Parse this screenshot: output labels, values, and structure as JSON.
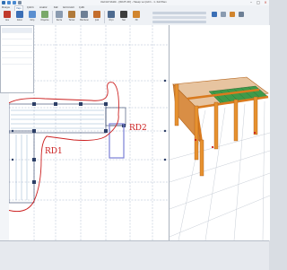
{
  "window": {
    "title": "IdeCAD Statik - [RD2F-2D] - Hesap ve Çizim - 1. Kat Planı",
    "controls": [
      "–",
      "□",
      "×"
    ]
  },
  "ribbon": {
    "tabs": [
      "Dosya",
      "Yapı",
      "Çizim",
      "Analiz",
      "Kat",
      "Görünüm",
      "Çıktı"
    ],
    "active_tab_index": 1,
    "labels": [
      "Aks",
      "Kolon",
      "Kiriş",
      "Döşeme",
      "Perde",
      "Temel",
      "Merdiven",
      "Çatı",
      "Ölçü",
      "Yazı",
      "3D"
    ]
  },
  "plan": {
    "annotations": [
      {
        "label": "RD1",
        "color": "#cc1f1f"
      },
      {
        "label": "RD2",
        "color": "#cc1f1f"
      }
    ]
  },
  "colors": {
    "annotation": "#cc1f1f",
    "beam": "#e38a22",
    "slab_mesh": "#2e8b3c",
    "grid": "#2c3e66",
    "highlight": "#7a7fd6"
  },
  "icons": [
    "save-icon",
    "undo-icon",
    "redo-icon",
    "print-icon"
  ]
}
